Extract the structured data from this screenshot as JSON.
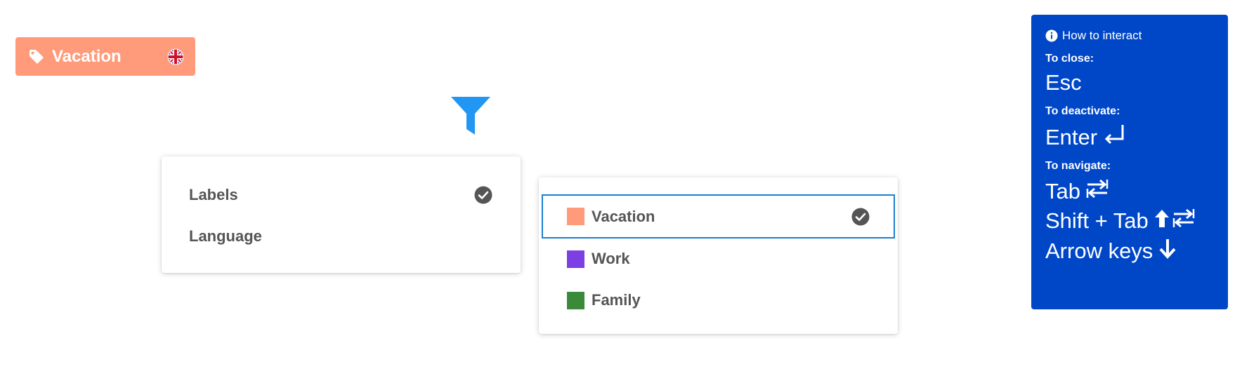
{
  "chip": {
    "label": "Vacation",
    "color": "#ff9b7b",
    "icon": "tag-icon",
    "flag_icon": "uk-flag-icon"
  },
  "filter_button": {
    "icon": "filter-icon",
    "color": "#2196f3"
  },
  "filter_menu": {
    "items": [
      {
        "label": "Labels",
        "selected": true
      },
      {
        "label": "Language",
        "selected": false
      }
    ]
  },
  "labels_menu": {
    "items": [
      {
        "label": "Vacation",
        "color": "#ff9b7b",
        "selected": true,
        "focused": true
      },
      {
        "label": "Work",
        "color": "#7b3fe4",
        "selected": false
      },
      {
        "label": "Family",
        "color": "#3a8a3a",
        "selected": false
      }
    ],
    "focus_color": "#1a7fd1"
  },
  "help_panel": {
    "background": "#0047c8",
    "title": "How to interact",
    "close_label": "To close:",
    "close_key": "Esc",
    "deactivate_label": "To deactivate:",
    "deactivate_key": "Enter",
    "navigate_label": "To navigate:",
    "navigate_keys": [
      "Tab",
      "Shift + Tab",
      "Arrow keys"
    ]
  }
}
